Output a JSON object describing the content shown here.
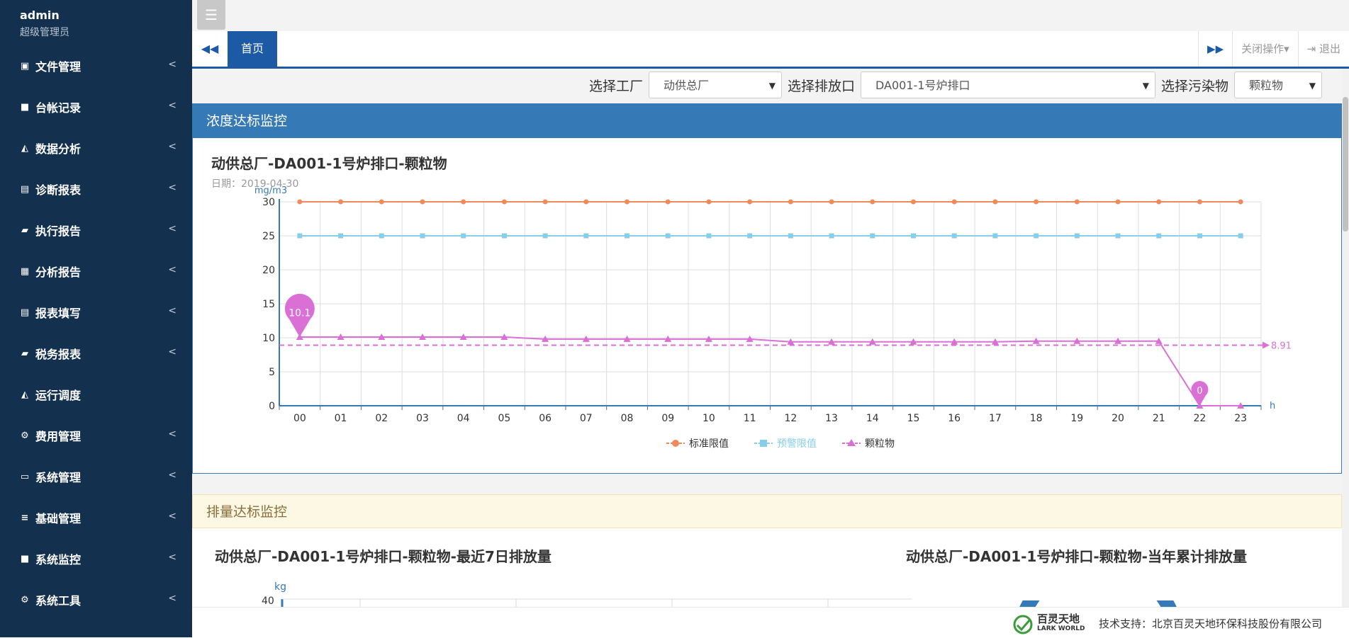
{
  "user": {
    "name": "admin",
    "role": "超级管理员"
  },
  "sidebar": {
    "items": [
      {
        "label": "文件管理",
        "icon": "briefcase-icon",
        "glyph": "▣",
        "arrow": true
      },
      {
        "label": "台帐记录",
        "icon": "video-icon",
        "glyph": "■",
        "arrow": true
      },
      {
        "label": "数据分析",
        "icon": "area-chart-icon",
        "glyph": "◭",
        "arrow": true
      },
      {
        "label": "诊断报表",
        "icon": "file-icon",
        "glyph": "▤",
        "arrow": true
      },
      {
        "label": "执行报告",
        "icon": "book-icon",
        "glyph": "▰",
        "arrow": true
      },
      {
        "label": "分析报告",
        "icon": "calculator-icon",
        "glyph": "▦",
        "arrow": true
      },
      {
        "label": "报表填写",
        "icon": "file-text-icon",
        "glyph": "▤",
        "arrow": true
      },
      {
        "label": "税务报表",
        "icon": "book-icon",
        "glyph": "▰",
        "arrow": true
      },
      {
        "label": "运行调度",
        "icon": "area-chart-icon",
        "glyph": "◭",
        "arrow": false
      },
      {
        "label": "费用管理",
        "icon": "gear-icon",
        "glyph": "⚙",
        "arrow": true
      },
      {
        "label": "系统管理",
        "icon": "desktop-icon",
        "glyph": "▭",
        "arrow": true
      },
      {
        "label": "基础管理",
        "icon": "list-icon",
        "glyph": "≡",
        "arrow": true
      },
      {
        "label": "系统监控",
        "icon": "video-icon",
        "glyph": "■",
        "arrow": true
      },
      {
        "label": "系统工具",
        "icon": "gear-icon",
        "glyph": "⚙",
        "arrow": true
      }
    ]
  },
  "tabs": {
    "home": "首页",
    "close_ops": "关闭操作▾",
    "logout": "退出"
  },
  "filters": {
    "factory_label": "选择工厂",
    "factory_value": "动供总厂",
    "outlet_label": "选择排放口",
    "outlet_value": "DA001-1号炉排口",
    "pollutant_label": "选择污染物",
    "pollutant_value": "颗粒物"
  },
  "panel1": {
    "header": "浓度达标监控",
    "title": "动供总厂-DA001-1号炉排口-颗粒物",
    "date": "日期：2019-04-30"
  },
  "panel2": {
    "header": "排量达标监控",
    "title_7day": "动供总厂-DA001-1号炉排口-颗粒物-最近7日排放量",
    "title_year": "动供总厂-DA001-1号炉排口-颗粒物-当年累计排放量",
    "unit": "kg",
    "tick_top": "40"
  },
  "footer": {
    "logo_cn": "百灵天地",
    "logo_en": "LARK WORLD",
    "support": "技术支持：北京百灵天地环保科技股份有限公司"
  },
  "chart_data": {
    "type": "line",
    "ylabel": "mg/m3",
    "xlabel": "h",
    "ylim": [
      0,
      30
    ],
    "yticks": [
      0,
      5,
      10,
      15,
      20,
      25,
      30
    ],
    "categories": [
      "00",
      "01",
      "02",
      "03",
      "04",
      "05",
      "06",
      "07",
      "08",
      "09",
      "10",
      "11",
      "12",
      "13",
      "14",
      "15",
      "16",
      "17",
      "18",
      "19",
      "20",
      "21",
      "22",
      "23"
    ],
    "legend_position": "bottom",
    "grid": true,
    "series": [
      {
        "name": "标准限值",
        "color": "#f08a5d",
        "marker": "circle",
        "values": [
          30,
          30,
          30,
          30,
          30,
          30,
          30,
          30,
          30,
          30,
          30,
          30,
          30,
          30,
          30,
          30,
          30,
          30,
          30,
          30,
          30,
          30,
          30,
          30
        ]
      },
      {
        "name": "预警限值",
        "color": "#87ceeb",
        "marker": "square",
        "values": [
          25,
          25,
          25,
          25,
          25,
          25,
          25,
          25,
          25,
          25,
          25,
          25,
          25,
          25,
          25,
          25,
          25,
          25,
          25,
          25,
          25,
          25,
          25,
          25
        ]
      },
      {
        "name": "颗粒物",
        "color": "#da70d6",
        "marker": "triangle",
        "values": [
          10.1,
          10.1,
          10.1,
          10.1,
          10.1,
          10.1,
          9.8,
          9.8,
          9.8,
          9.8,
          9.8,
          9.8,
          9.4,
          9.4,
          9.4,
          9.4,
          9.4,
          9.4,
          9.5,
          9.5,
          9.5,
          9.5,
          0,
          0
        ]
      }
    ],
    "mark_points": [
      {
        "label": "10.1",
        "index": 0
      },
      {
        "label": "0",
        "index": 22
      }
    ],
    "mark_line": {
      "label": "8.91",
      "value": 8.91
    }
  }
}
